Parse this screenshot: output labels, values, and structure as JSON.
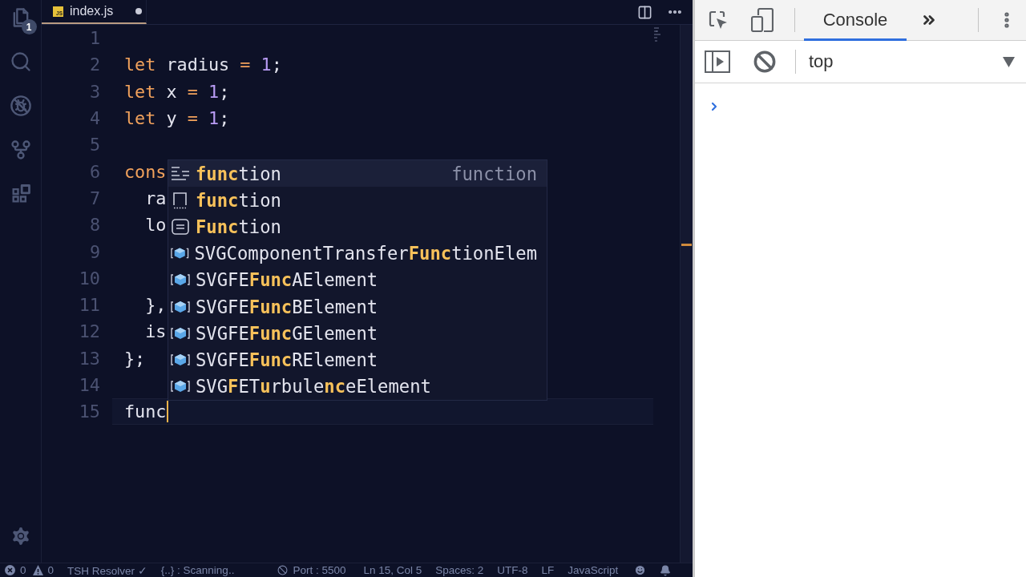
{
  "activity_bar": {
    "items": [
      {
        "kind": "files",
        "badge": "1"
      },
      {
        "kind": "search"
      },
      {
        "kind": "debug"
      },
      {
        "kind": "source_control"
      },
      {
        "kind": "extensions"
      }
    ],
    "footer": [
      {
        "kind": "settings"
      }
    ]
  },
  "editor": {
    "tabs": [
      {
        "icon_text": "JS",
        "label": "index.js",
        "selected": true,
        "modified": true
      }
    ],
    "lines": [
      {
        "number": "1",
        "current": false
      },
      {
        "number": "2",
        "current": false,
        "tokens": [
          {
            "kind": "keyword",
            "text": "let"
          },
          {
            "kind": "plain",
            "text": " radius "
          },
          {
            "kind": "operator",
            "text": "= "
          },
          {
            "kind": "number",
            "text": "1"
          },
          {
            "kind": "plain",
            "text": ";"
          }
        ]
      },
      {
        "number": "3",
        "current": false,
        "tokens": [
          {
            "kind": "keyword",
            "text": "let"
          },
          {
            "kind": "plain",
            "text": " x "
          },
          {
            "kind": "operator",
            "text": "= "
          },
          {
            "kind": "number",
            "text": "1"
          },
          {
            "kind": "plain",
            "text": ";"
          }
        ]
      },
      {
        "number": "4",
        "current": false,
        "tokens": [
          {
            "kind": "keyword",
            "text": "let"
          },
          {
            "kind": "plain",
            "text": " y "
          },
          {
            "kind": "operator",
            "text": "= "
          },
          {
            "kind": "number",
            "text": "1"
          },
          {
            "kind": "plain",
            "text": ";"
          }
        ]
      },
      {
        "number": "5",
        "current": false
      },
      {
        "number": "6",
        "current": false,
        "tokens": [
          {
            "kind": "keyword",
            "text": "cons"
          }
        ]
      },
      {
        "number": "7",
        "current": false,
        "tokens": [
          {
            "kind": "plain",
            "text": "  ra"
          }
        ]
      },
      {
        "number": "8",
        "current": false,
        "tokens": [
          {
            "kind": "plain",
            "text": "  lo"
          }
        ]
      },
      {
        "number": "9",
        "current": false
      },
      {
        "number": "10",
        "current": false
      },
      {
        "number": "11",
        "current": false,
        "tokens": [
          {
            "kind": "plain",
            "text": "  },"
          }
        ]
      },
      {
        "number": "12",
        "current": false,
        "tokens": [
          {
            "kind": "plain",
            "text": "  is"
          }
        ]
      },
      {
        "number": "13",
        "current": false,
        "tokens": [
          {
            "kind": "plain",
            "text": "};"
          }
        ]
      },
      {
        "number": "14",
        "current": false
      },
      {
        "number": "15",
        "current": true,
        "tokens": [
          {
            "kind": "plain",
            "text": "func"
          }
        ]
      }
    ],
    "suggestions": [
      {
        "kind": "text",
        "label": "**func**tion",
        "detail": "function",
        "selected": true
      },
      {
        "kind": "snippet",
        "label": "**func**tion",
        "selected": false
      },
      {
        "kind": "module",
        "label": "**Func**tion",
        "selected": false
      },
      {
        "kind": "class",
        "label": "SVGComponentTransfer**Func**tionElem",
        "selected": false
      },
      {
        "kind": "class",
        "label": "SVGFE**Func**AElement",
        "selected": false
      },
      {
        "kind": "class",
        "label": "SVGFE**Func**BElement",
        "selected": false
      },
      {
        "kind": "class",
        "label": "SVGFE**Func**GElement",
        "selected": false
      },
      {
        "kind": "class",
        "label": "SVGFE**Func**RElement",
        "selected": false
      },
      {
        "kind": "class",
        "label": "SVG**F**ET**u**rbule**nc**eElement",
        "selected": false
      }
    ]
  },
  "devtools": {
    "tabs": [
      {
        "label": "Console",
        "selected": true
      }
    ],
    "context": "top"
  },
  "status_bar": {
    "errors": "0",
    "warnings": "0",
    "left": [
      {
        "kind": "plain",
        "text": "TSH Resolver ✓"
      },
      {
        "kind": "plain",
        "text": "{..} : Scanning.."
      },
      {
        "kind": "port",
        "text": "Port : 5500"
      }
    ],
    "right": [
      "Ln 15, Col 5",
      "Spaces: 2",
      "UTF-8",
      "LF",
      "JavaScript"
    ]
  }
}
